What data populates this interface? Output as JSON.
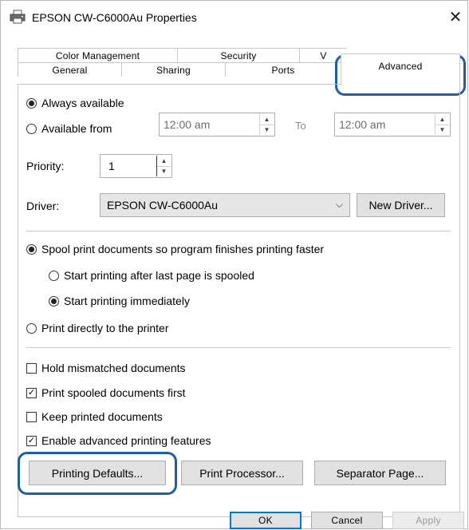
{
  "window": {
    "title": "EPSON CW-C6000Au Properties",
    "icons": {
      "app": "printer-icon",
      "close": "close-icon"
    },
    "close_glyph": "✕"
  },
  "tabs": {
    "row1": [
      "Color Management",
      "Security",
      "V"
    ],
    "row2": [
      "General",
      "Sharing",
      "Ports",
      "Advanced"
    ],
    "active": "Advanced"
  },
  "availability": {
    "always": "Always available",
    "from": "Available from",
    "from_time": "12:00 am",
    "to_label": "To",
    "to_time": "12:00 am",
    "selected": "always"
  },
  "priority": {
    "label": "Priority:",
    "value": "1"
  },
  "driver": {
    "label": "Driver:",
    "value": "EPSON CW-C6000Au",
    "new_driver": "New Driver..."
  },
  "spool": {
    "spool_option": "Spool print documents so program finishes printing faster",
    "after_last": "Start printing after last page is spooled",
    "immediately": "Start printing immediately",
    "direct": "Print directly to the printer"
  },
  "checks": [
    {
      "label": "Hold mismatched documents",
      "checked": false
    },
    {
      "label": "Print spooled documents first",
      "checked": true
    },
    {
      "label": "Keep printed documents",
      "checked": false
    },
    {
      "label": "Enable advanced printing features",
      "checked": true
    }
  ],
  "buttons": {
    "printing_defaults": "Printing Defaults...",
    "print_processor": "Print Processor...",
    "separator_page": "Separator Page..."
  },
  "footer": {
    "ok": "OK",
    "cancel": "Cancel",
    "apply": "Apply"
  },
  "highlight_color": "#1e5ea9"
}
